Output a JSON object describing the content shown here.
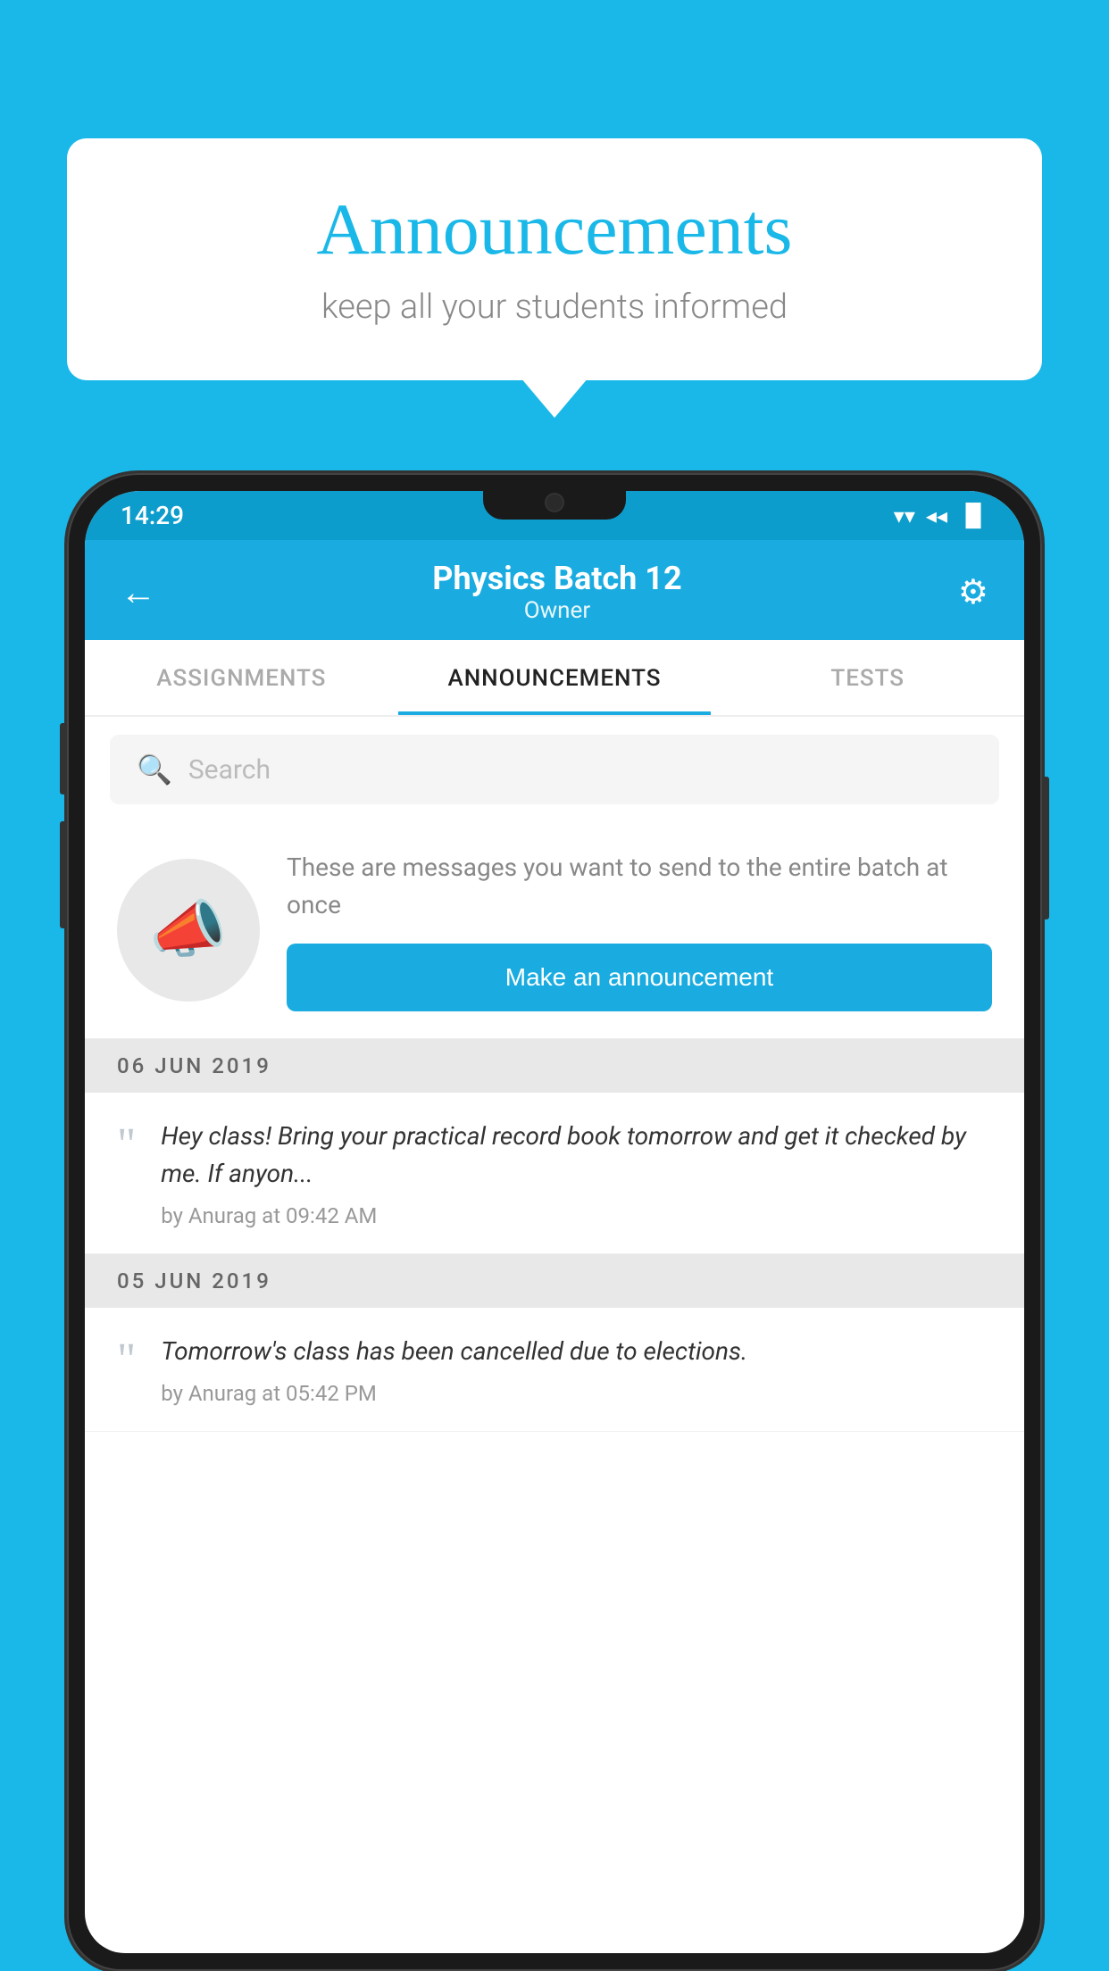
{
  "background_color": "#1ab8e8",
  "speech_bubble": {
    "title": "Announcements",
    "subtitle": "keep all your students informed"
  },
  "status_bar": {
    "time": "14:29",
    "wifi_icon": "▼",
    "signal_icon": "◄",
    "battery_icon": "▐"
  },
  "header": {
    "back_label": "←",
    "title": "Physics Batch 12",
    "subtitle": "Owner",
    "gear_label": "⚙"
  },
  "tabs": [
    {
      "label": "ASSIGNMENTS",
      "active": false
    },
    {
      "label": "ANNOUNCEMENTS",
      "active": true
    },
    {
      "label": "TESTS",
      "active": false
    },
    {
      "label": "...",
      "active": false
    }
  ],
  "search": {
    "placeholder": "Search"
  },
  "announcement_prompt": {
    "description_text": "These are messages you want to send to the entire batch at once",
    "button_label": "Make an announcement"
  },
  "announcements": [
    {
      "date_separator": "06  JUN  2019",
      "text": "Hey class! Bring your practical record book tomorrow and get it checked by me. If anyon...",
      "meta": "by Anurag at 09:42 AM"
    },
    {
      "date_separator": "05  JUN  2019",
      "text": "Tomorrow's class has been cancelled due to elections.",
      "meta": "by Anurag at 05:42 PM"
    }
  ]
}
